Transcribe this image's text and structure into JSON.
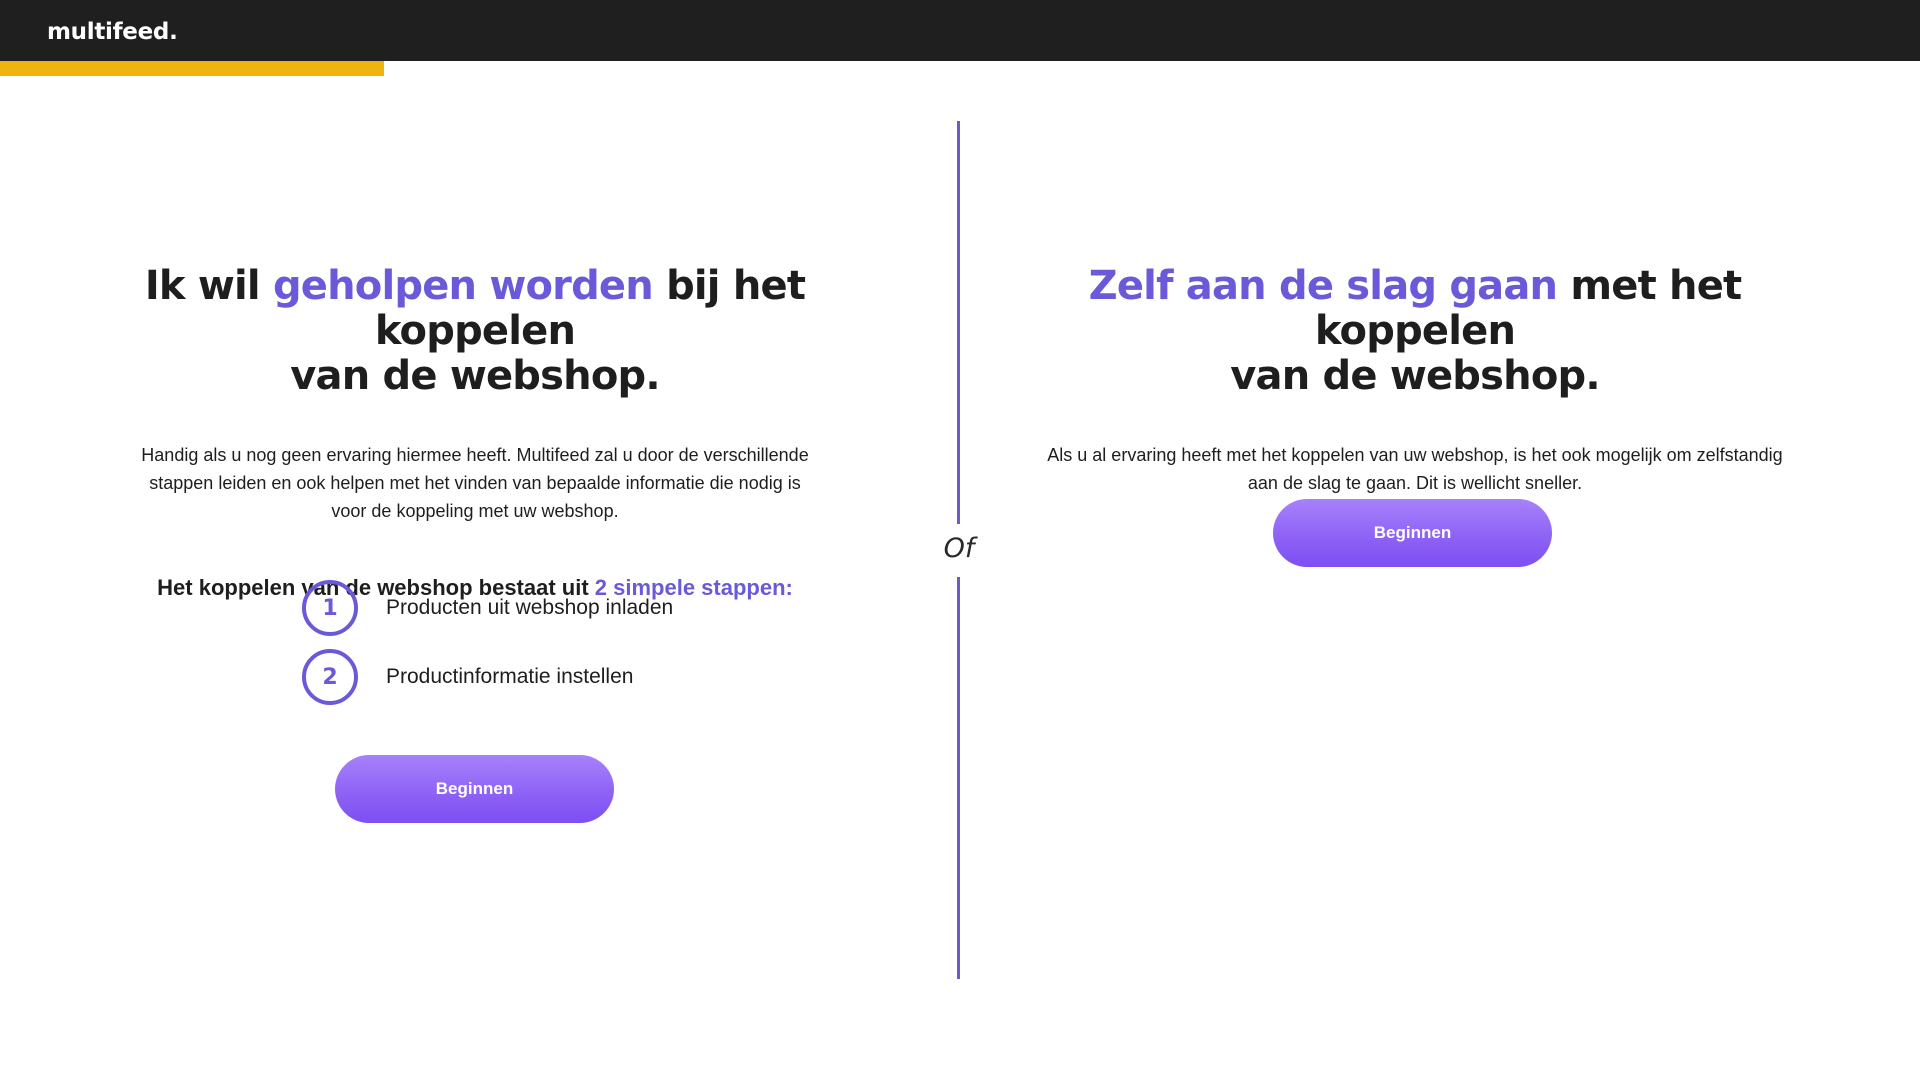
{
  "header": {
    "logo": "multifeed.",
    "progress_fraction": 0.2
  },
  "divider": {
    "label": "Of"
  },
  "left_option": {
    "heading_pre": "Ik wil ",
    "heading_accent": "geholpen worden",
    "heading_post1": " bij het koppelen",
    "heading_post2": "van de webshop.",
    "body": "Handig als u nog geen ervaring hiermee heeft. Multifeed zal u door de verschillende stappen leiden en ook helpen met het vinden van bepaalde informatie die nodig is voor de koppeling met uw webshop.",
    "steps_title_pre": "Het koppelen van de webshop bestaat uit ",
    "steps_title_accent": "2 simpele stappen:",
    "steps": [
      {
        "number": "1",
        "label": "Producten uit webshop inladen"
      },
      {
        "number": "2",
        "label": "Productinformatie instellen"
      }
    ],
    "button_label": "Beginnen"
  },
  "right_option": {
    "heading_accent": "Zelf aan de slag gaan",
    "heading_post1": " met het koppelen",
    "heading_post2": "van de webshop.",
    "body": "Als u al ervaring heeft met het koppelen van uw webshop, is het ook mogelijk om zelfstandig aan de slag te gaan. Dit is wellicht sneller.",
    "button_label": "Beginnen"
  },
  "colors": {
    "accent": "#6a5ad9",
    "progress": "#efb40d",
    "topbar": "#1f1f1f",
    "button": "#8e63f6"
  }
}
